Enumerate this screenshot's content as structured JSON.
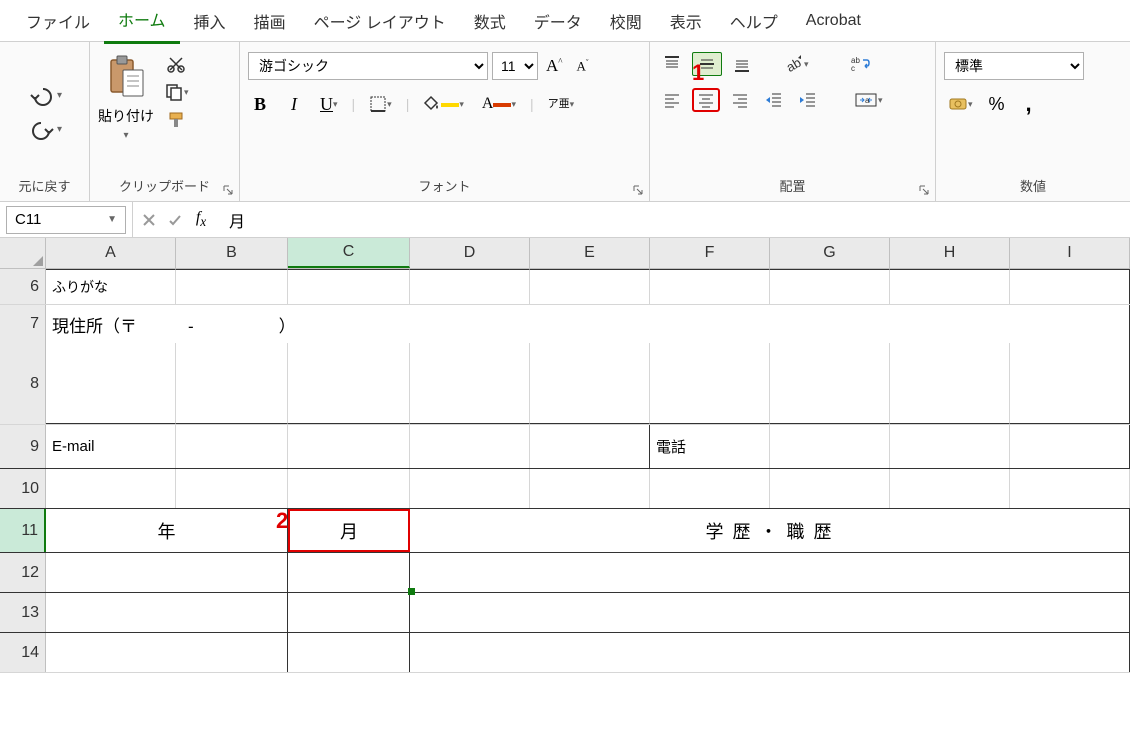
{
  "tabs": {
    "file": "ファイル",
    "home": "ホーム",
    "insert": "挿入",
    "draw": "描画",
    "layout": "ページ レイアウト",
    "formulas": "数式",
    "data": "データ",
    "review": "校閲",
    "view": "表示",
    "help": "ヘルプ",
    "acrobat": "Acrobat"
  },
  "ribbon": {
    "undo_group": "元に戻す",
    "clipboard": {
      "paste": "貼り付け",
      "label": "クリップボード"
    },
    "font": {
      "name": "游ゴシック",
      "size": "11",
      "bold": "B",
      "italic": "I",
      "label": "フォント",
      "phonetic": "ア亜"
    },
    "alignment": {
      "label": "配置"
    },
    "number": {
      "format": "標準",
      "label": "数値",
      "percent": "%",
      "comma": ","
    }
  },
  "namebox": "C11",
  "formula": "月",
  "columns": [
    "A",
    "B",
    "C",
    "D",
    "E",
    "F",
    "G",
    "H",
    "I"
  ],
  "rows_visible": [
    "6",
    "7",
    "8",
    "9",
    "10",
    "11",
    "12",
    "13",
    "14"
  ],
  "cells": {
    "r6": {
      "a": "ふりがな"
    },
    "r7": {
      "a": "現住所（〒　　　-　　　　　）"
    },
    "r9": {
      "a": "E-mail",
      "f": "電話"
    },
    "r11": {
      "a": "年",
      "c": "月",
      "d": "学 歴 ・ 職 歴"
    }
  },
  "annotations": {
    "a1": "1",
    "a2": "2"
  },
  "active_cell": "C11"
}
